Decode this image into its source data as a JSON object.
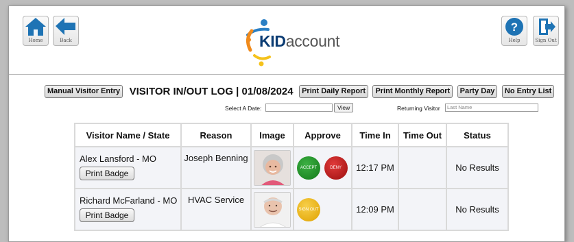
{
  "header": {
    "home_label": "Home",
    "back_label": "Back",
    "help_label": "Help",
    "signout_label": "Sign Out",
    "logo_text_bold": "KID",
    "logo_text_rest": "account",
    "colors": {
      "nav_blue": "#1e73b4",
      "logo_navy": "#0b3c73",
      "logo_orange": "#f08a1c",
      "logo_yellow": "#f5c21b",
      "logo_blue": "#2a7fc4"
    }
  },
  "toolbar": {
    "manual_entry": "Manual Visitor Entry",
    "title": "VISITOR IN/OUT LOG | 01/08/2024",
    "print_daily": "Print Daily Report",
    "print_monthly": "Print Monthly Report",
    "party_day": "Party Day",
    "no_entry": "No Entry List"
  },
  "filters": {
    "select_date_label": "Select A Date:",
    "date_value": "",
    "view_button": "View",
    "returning_label": "Returning Visitor",
    "last_name_placeholder": "Last Name"
  },
  "table": {
    "headers": [
      "Visitor Name / State",
      "Reason",
      "Image",
      "Approve",
      "Time In",
      "Time Out",
      "Status"
    ],
    "rows": [
      {
        "name": "Alex Lansford - MO",
        "badge": "Print Badge",
        "reason": "Joseph Benning",
        "accept": "ACCEPT",
        "deny": "DENY",
        "time_in": "12:17 PM",
        "time_out": "",
        "status": "No Results"
      },
      {
        "name": "Richard McFarland - MO",
        "badge": "Print Badge",
        "reason": "HVAC Service",
        "signout": "SIGN OUT",
        "time_in": "12:09 PM",
        "time_out": "",
        "status": "No Results"
      }
    ]
  }
}
